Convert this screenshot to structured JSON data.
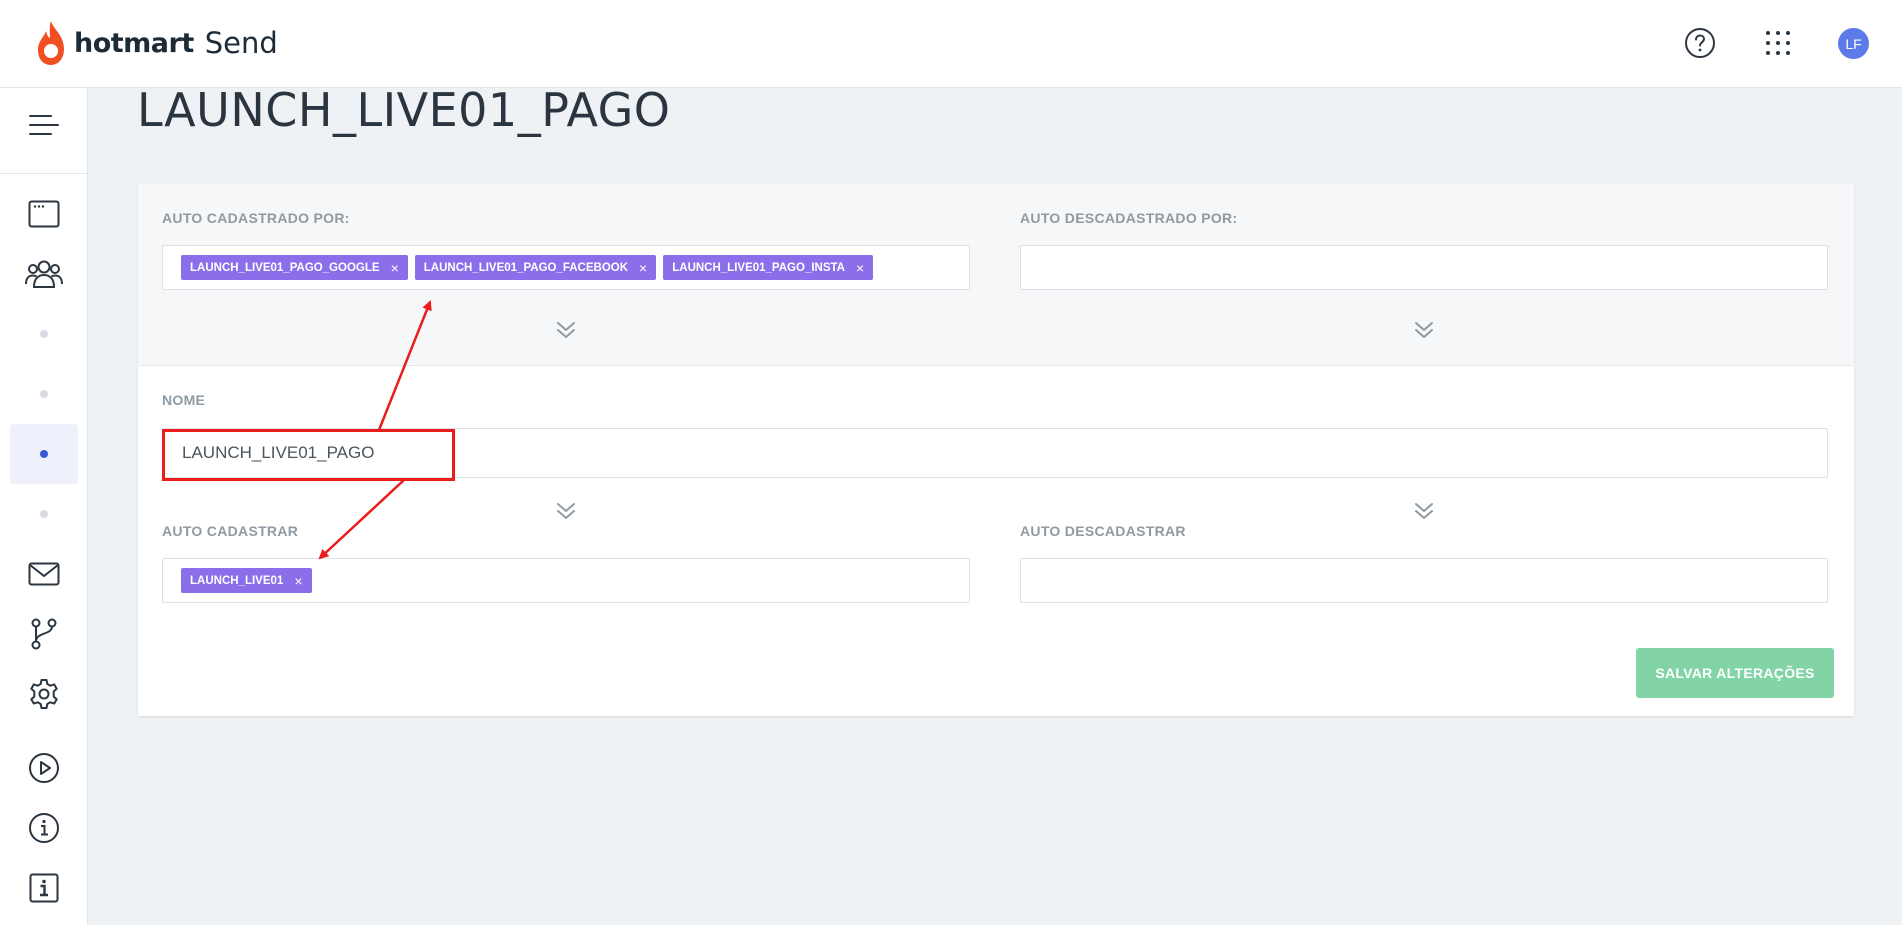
{
  "header": {
    "brand": "hotmart",
    "product": "Send",
    "help_icon": "question-circle-icon",
    "apps_icon": "grid-dots-icon",
    "avatar_initials": "LF",
    "avatar_color": "#5c7be8"
  },
  "sidebar": {
    "items": [
      {
        "icon": "menu-icon"
      },
      {
        "icon": "browser-window-icon"
      },
      {
        "icon": "users-icon"
      },
      {
        "icon": "dot-icon"
      },
      {
        "icon": "dot-icon"
      },
      {
        "icon": "dot-icon",
        "active": true
      },
      {
        "icon": "dot-icon"
      },
      {
        "icon": "mail-icon"
      },
      {
        "icon": "flow-branch-icon"
      },
      {
        "icon": "gear-icon"
      },
      {
        "icon": "play-circle-icon"
      },
      {
        "icon": "info-circle-icon"
      },
      {
        "icon": "info-square-icon"
      }
    ]
  },
  "page": {
    "title": "LAUNCH_LIVE01_PAGO"
  },
  "form": {
    "auto_cadastrado_por": {
      "label": "AUTO CADASTRADO POR:",
      "tags": [
        "LAUNCH_LIVE01_PAGO_GOOGLE",
        "LAUNCH_LIVE01_PAGO_FACEBOOK",
        "LAUNCH_LIVE01_PAGO_INSTA"
      ]
    },
    "auto_descadastrado_por": {
      "label": "AUTO DESCADASTRADO POR:",
      "tags": []
    },
    "nome": {
      "label": "NOME",
      "value": "LAUNCH_LIVE01_PAGO"
    },
    "auto_cadastrar": {
      "label": "AUTO CADASTRAR",
      "tags": [
        "LAUNCH_LIVE01"
      ]
    },
    "auto_descadastrar": {
      "label": "AUTO DESCADASTRAR",
      "tags": []
    },
    "remove_glyph": "×",
    "save_label": "SALVAR ALTERAÇÕES"
  },
  "colors": {
    "tag": "#8b6ee9",
    "save_button": "#82d4a6",
    "annotation": "#ea1c1c"
  }
}
